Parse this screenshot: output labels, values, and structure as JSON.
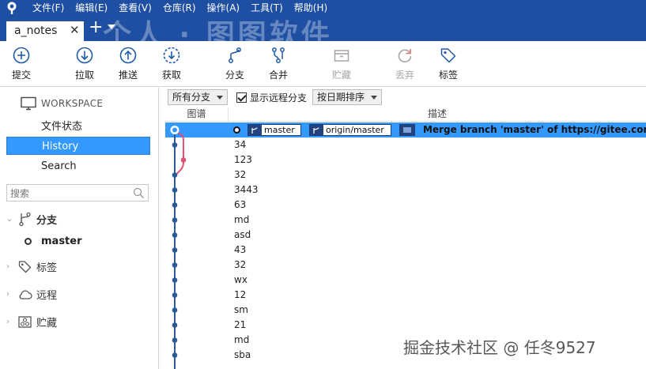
{
  "menu": {
    "items": [
      "文件(F)",
      "编辑(E)",
      "查看(V)",
      "仓库(R)",
      "操作(A)",
      "工具(T)",
      "帮助(H)"
    ]
  },
  "tabs": {
    "active_label": "a_notes",
    "close_glyph": "✕",
    "add_glyph": "+"
  },
  "watermark": {
    "top": "个人 · 图图软件",
    "bottom": "掘金技术社区 @ 任冬9527"
  },
  "toolbar": {
    "commit": "提交",
    "pull": "拉取",
    "push": "推送",
    "fetch": "获取",
    "branch": "分支",
    "merge": "合并",
    "stash": "贮藏",
    "discard": "丢弃",
    "tag": "标签",
    "accent_color": "#1e5aa8",
    "disabled_color": "#a6a6a6"
  },
  "sidebar": {
    "workspace_label": "WORKSPACE",
    "file_status": "文件状态",
    "history": "History",
    "search": "Search",
    "search_placeholder": "搜索",
    "branches_label": "分支",
    "current_branch": "master",
    "tags_label": "标签",
    "remotes_label": "远程",
    "stashes_label": "贮藏",
    "selected_color": "#3399ff"
  },
  "filters": {
    "branches": "所有分支",
    "show_remote": "显示远程分支",
    "show_remote_checked": true,
    "order": "按日期排序"
  },
  "columns": {
    "graph": "图谱",
    "description": "描述"
  },
  "refs": {
    "local": "master",
    "remote": "origin/master"
  },
  "commits": [
    "Merge branch 'master' of https://gitee.com/yr",
    "34",
    "123",
    "32",
    "3443",
    "63",
    "md",
    "asd",
    "43",
    "32",
    "wx",
    "12",
    "sm",
    "21",
    "md",
    "sba"
  ],
  "graph_colors": {
    "main": "#2d5a96",
    "merge": "#e05070"
  }
}
